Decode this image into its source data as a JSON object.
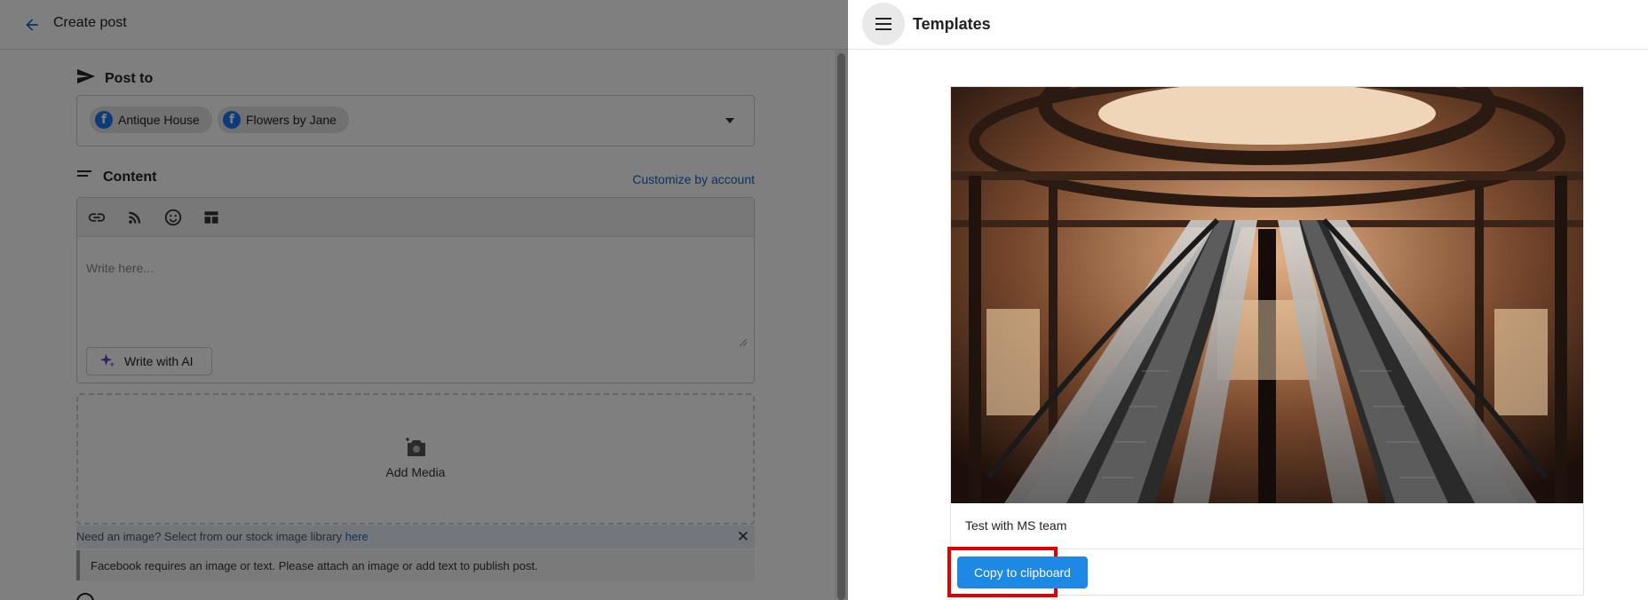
{
  "left": {
    "header_title": "Create post",
    "post_to_label": "Post to",
    "accounts": [
      "Antique House",
      "Flowers by Jane"
    ],
    "content_label": "Content",
    "customize_link": "Customize by account",
    "editor_placeholder": "Write here...",
    "ai_button": "Write with AI",
    "add_media": "Add Media",
    "stock_text": "Need an image? Select from our stock image library ",
    "stock_link": "here",
    "fb_warning": "Facebook requires an image or text. Please attach an image or add text to publish post."
  },
  "right": {
    "title": "Templates",
    "template_name": "Test with MS team",
    "copy_button": "Copy to clipboard"
  },
  "colors": {
    "accent": "#1e88e5",
    "link": "#1565c0",
    "highlight": "#e00000",
    "facebook": "#1877f2"
  }
}
